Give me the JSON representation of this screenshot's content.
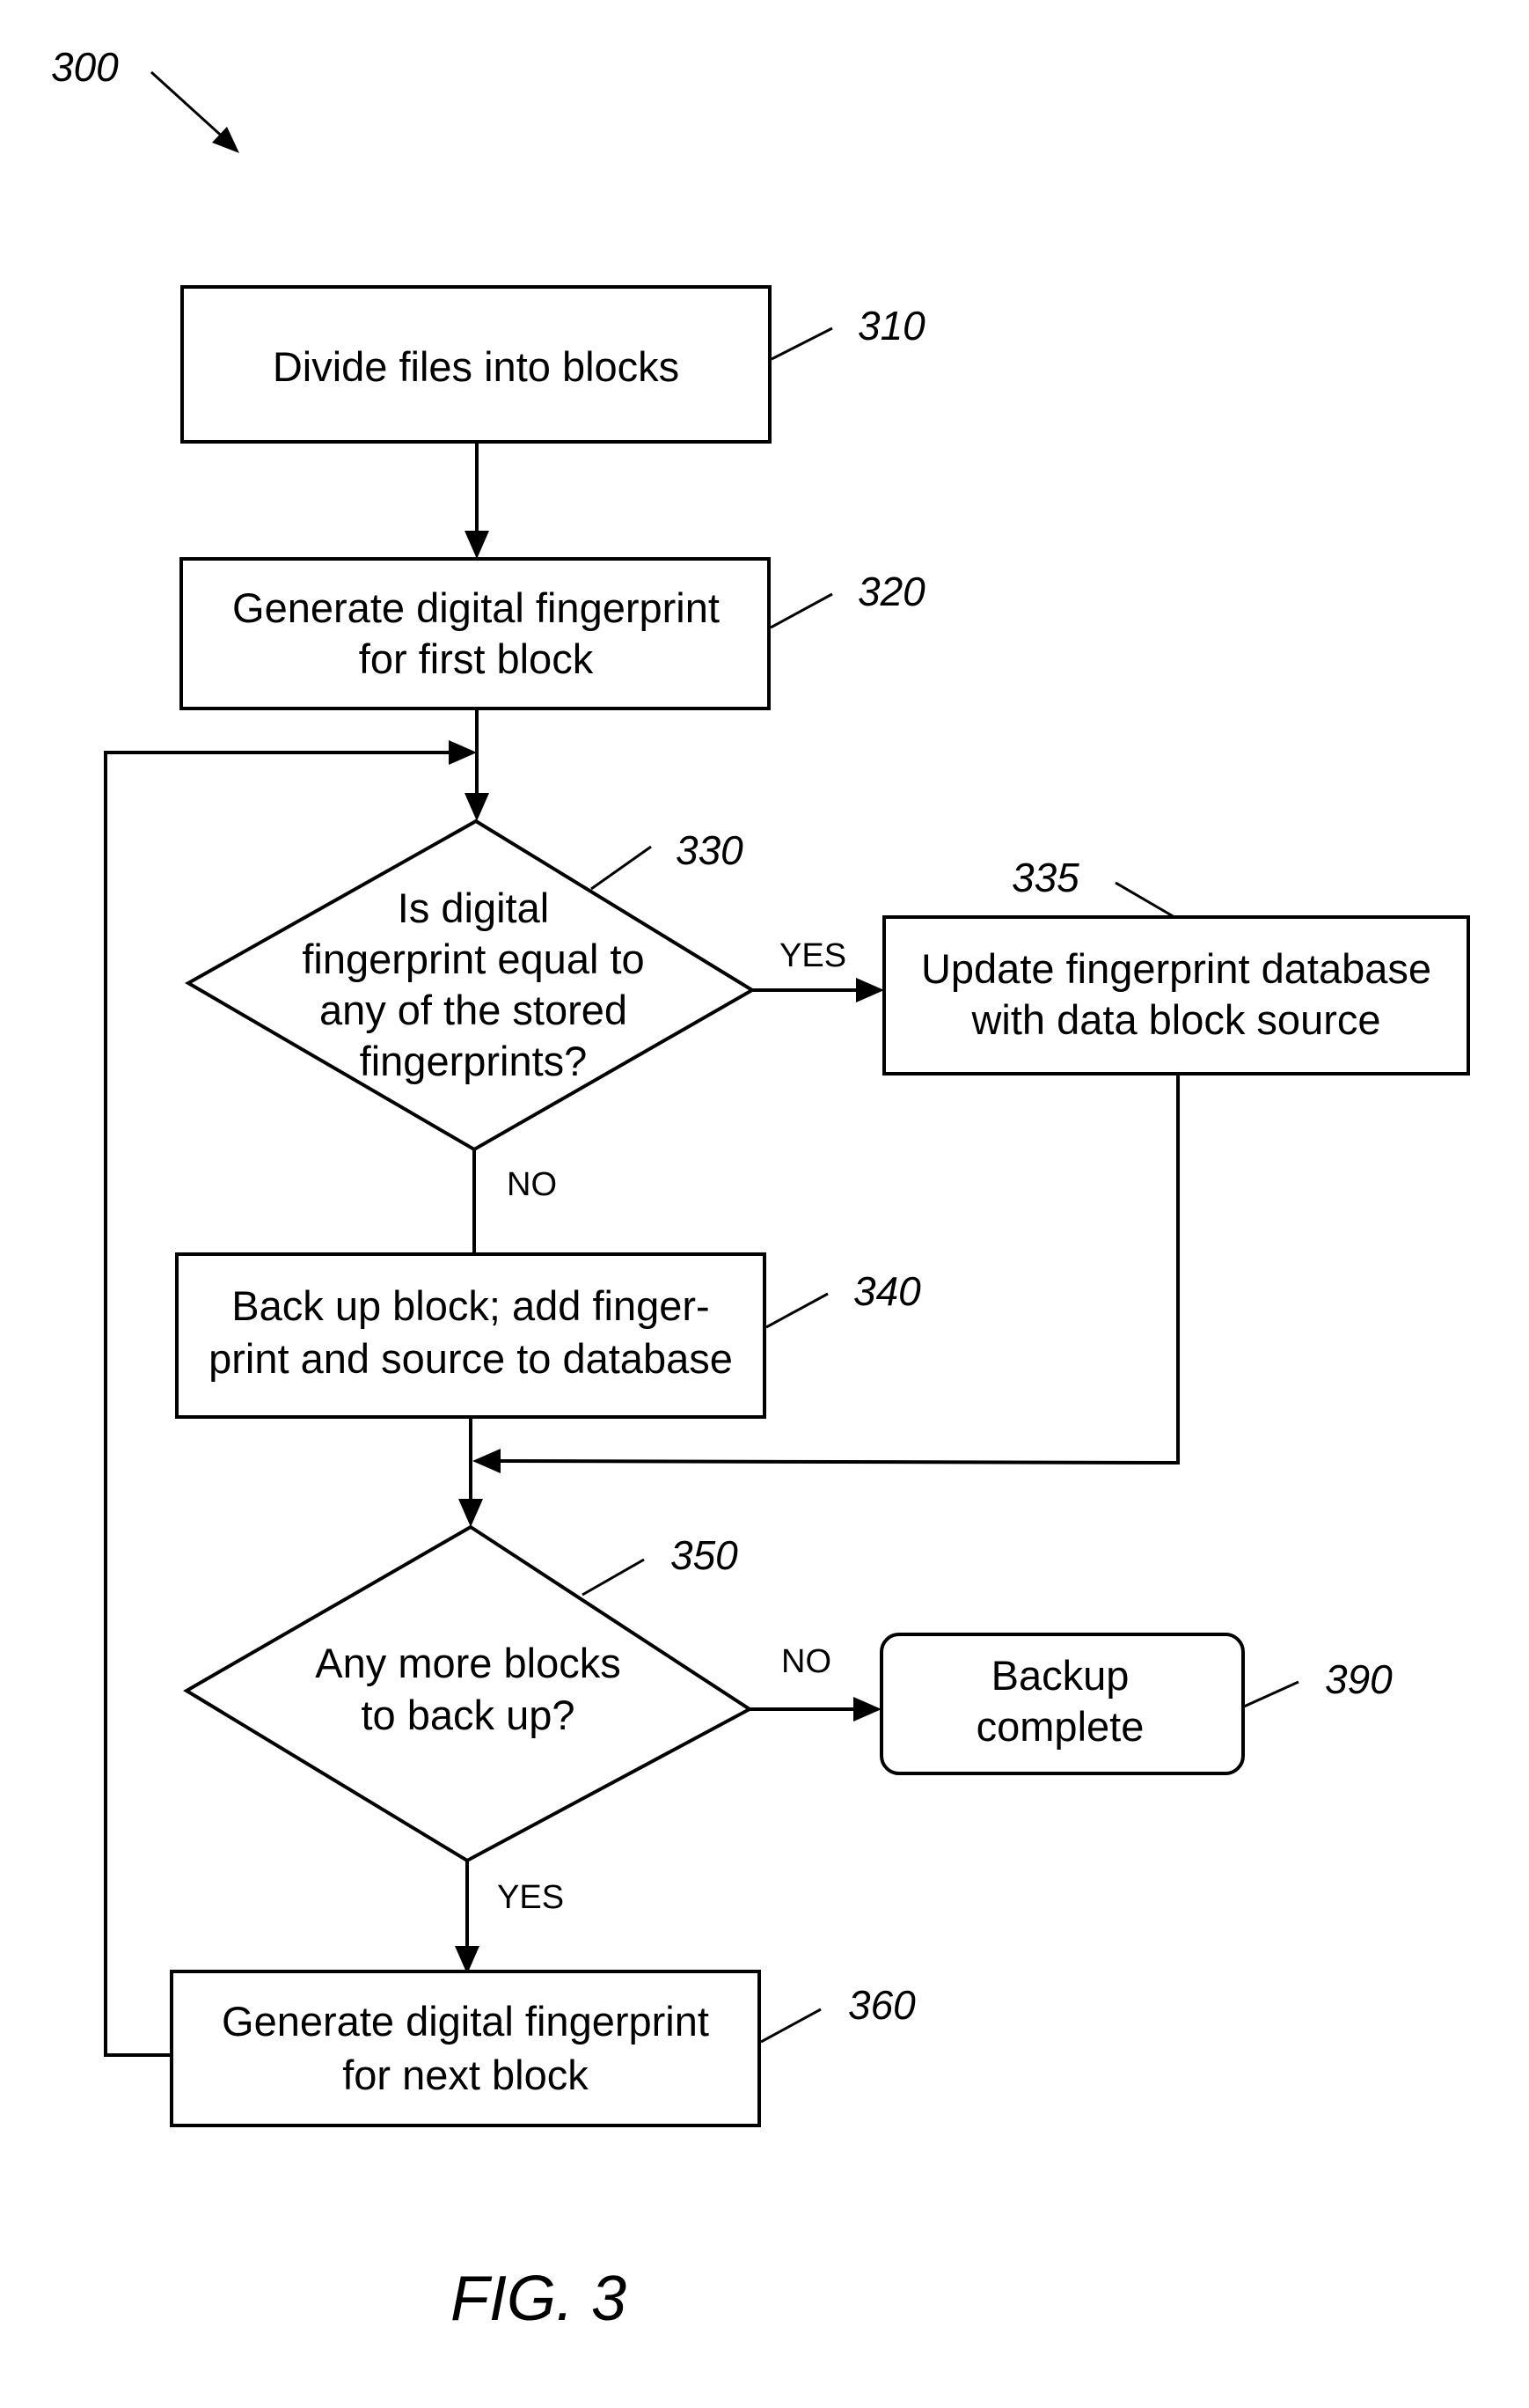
{
  "figure": {
    "number_ref": "300",
    "caption": "FIG. 3"
  },
  "nodes": {
    "n310": {
      "ref": "310",
      "type": "process",
      "lines": [
        "Divide files into blocks"
      ]
    },
    "n320": {
      "ref": "320",
      "type": "process",
      "lines": [
        "Generate digital fingerprint",
        "for first block"
      ]
    },
    "n330": {
      "ref": "330",
      "type": "decision",
      "lines": [
        "Is digital",
        "fingerprint equal to",
        "any of the stored",
        "fingerprints?"
      ]
    },
    "n335": {
      "ref": "335",
      "type": "process",
      "lines": [
        "Update fingerprint database",
        "with data block source"
      ]
    },
    "n340": {
      "ref": "340",
      "type": "process",
      "lines": [
        "Back up block; add finger-",
        "print and source to database"
      ]
    },
    "n350": {
      "ref": "350",
      "type": "decision",
      "lines": [
        "Any more blocks",
        "to back up?"
      ]
    },
    "n360": {
      "ref": "360",
      "type": "process",
      "lines": [
        "Generate digital fingerprint",
        "for next block"
      ]
    },
    "n390": {
      "ref": "390",
      "type": "terminal",
      "lines": [
        "Backup",
        "complete"
      ]
    }
  },
  "edges": {
    "e330_yes": "YES",
    "e330_no": "NO",
    "e350_no": "NO",
    "e350_yes": "YES"
  },
  "connections": [
    {
      "from": "310",
      "to": "320"
    },
    {
      "from": "320",
      "to": "330"
    },
    {
      "from": "330",
      "to": "335",
      "label": "YES"
    },
    {
      "from": "330",
      "to": "340",
      "label": "NO"
    },
    {
      "from": "335",
      "to": "350"
    },
    {
      "from": "340",
      "to": "350"
    },
    {
      "from": "350",
      "to": "390",
      "label": "NO"
    },
    {
      "from": "350",
      "to": "360",
      "label": "YES"
    },
    {
      "from": "360",
      "to": "330"
    }
  ]
}
